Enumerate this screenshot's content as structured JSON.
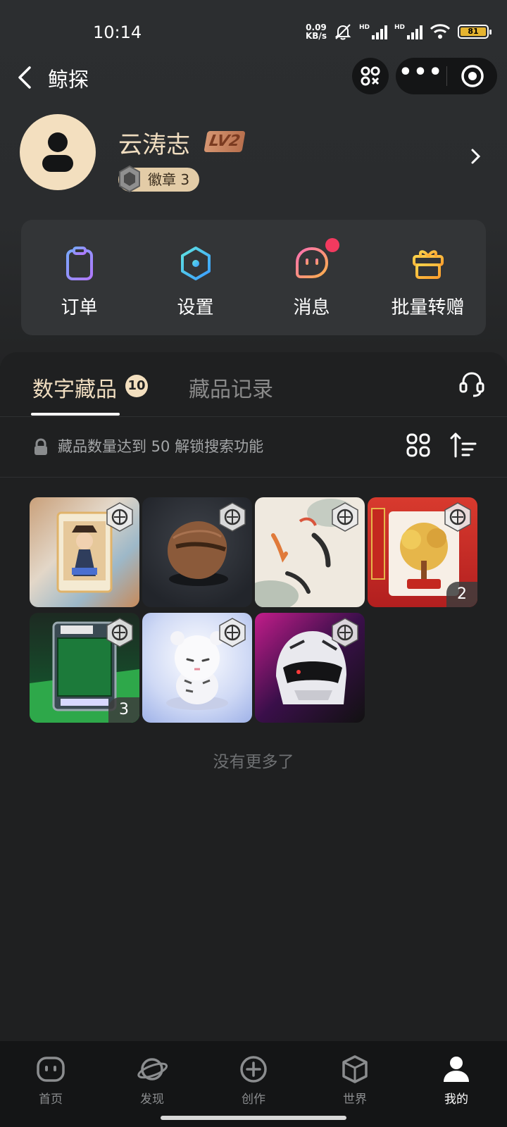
{
  "status_bar": {
    "time": "10:14",
    "net_speed_value": "0.09",
    "net_speed_unit": "KB/s",
    "sim1_tag": "HD",
    "sim2_tag": "HD",
    "battery_level": "81"
  },
  "nav": {
    "title": "鲸探",
    "more_label": "•••"
  },
  "profile": {
    "username": "云涛志",
    "level": "LV2",
    "badge_label": "徽章 3"
  },
  "actions": [
    {
      "label": "订单",
      "icon": "clipboard-icon"
    },
    {
      "label": "设置",
      "icon": "hexagon-settings-icon"
    },
    {
      "label": "消息",
      "icon": "message-face-icon"
    },
    {
      "label": "批量转赠",
      "icon": "gift-icon"
    }
  ],
  "tabs": {
    "active_label": "数字藏品",
    "active_count": "10",
    "inactive_label": "藏品记录"
  },
  "search_hint": "藏品数量达到 50 解锁搜索功能",
  "collection": [
    {
      "name": "anime-card",
      "qty": ""
    },
    {
      "name": "walnut",
      "qty": ""
    },
    {
      "name": "koi-fish",
      "qty": ""
    },
    {
      "name": "golden-money-tree",
      "qty": "2"
    },
    {
      "name": "billiards-card",
      "qty": "3"
    },
    {
      "name": "white-tiger",
      "qty": ""
    },
    {
      "name": "racing-helmet",
      "qty": ""
    }
  ],
  "no_more": "没有更多了",
  "bottom_nav": [
    {
      "label": "首页"
    },
    {
      "label": "发现"
    },
    {
      "label": "创作"
    },
    {
      "label": "世界"
    },
    {
      "label": "我的"
    }
  ],
  "colors": {
    "accent_gold": "#f0ddc0",
    "badge_red": "#f23a5f",
    "background": "#1f2021"
  }
}
